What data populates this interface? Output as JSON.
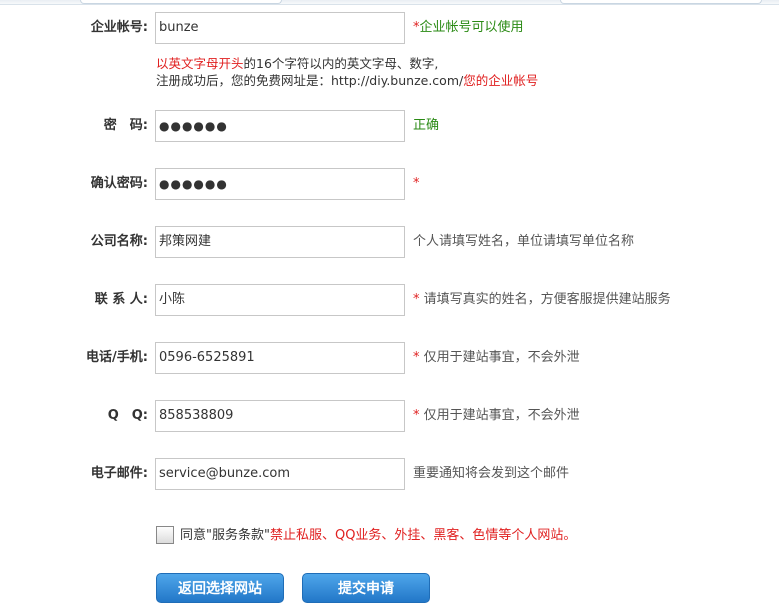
{
  "form": {
    "account": {
      "label": "企业帐号:",
      "value": "bunze",
      "hint_star": "*",
      "hint": "企业帐号可以使用",
      "note_line1_red": "以英文字母开头",
      "note_line1_rest": "的16个字符以内的英文字母、数字,",
      "note_line2_prefix": "注册成功后，您的免费网址是：http://diy.bunze.com/",
      "note_line2_red": "您的企业帐号"
    },
    "password": {
      "label": "密　码:",
      "value": "●●●●●●",
      "hint": "正确"
    },
    "confirm": {
      "label": "确认密码:",
      "value": "●●●●●●",
      "hint_star": "*"
    },
    "company": {
      "label": "公司名称:",
      "value": "邦策网建",
      "hint": "个人请填写姓名，单位请填写单位名称"
    },
    "contact": {
      "label": "联 系 人:",
      "value": "小陈",
      "hint_star": "*",
      "hint": "请填写真实的姓名，方便客服提供建站服务"
    },
    "phone": {
      "label": "电话/手机:",
      "value": "0596-6525891",
      "hint_star": "*",
      "hint": "仅用于建站事宜，不会外泄"
    },
    "qq": {
      "label": "Q　Q:",
      "value": "858538809",
      "hint_star": "*",
      "hint": "仅用于建站事宜，不会外泄"
    },
    "email": {
      "label": "电子邮件:",
      "value": "service@bunze.com",
      "hint": "重要通知将会发到这个邮件"
    }
  },
  "agreement": {
    "prefix": "同意\"服务条款\"",
    "warning": "禁止私服、QQ业务、外挂、黑客、色情等个人网站。",
    "checked": false
  },
  "buttons": {
    "back": "返回选择网站",
    "submit": "提交申请"
  }
}
